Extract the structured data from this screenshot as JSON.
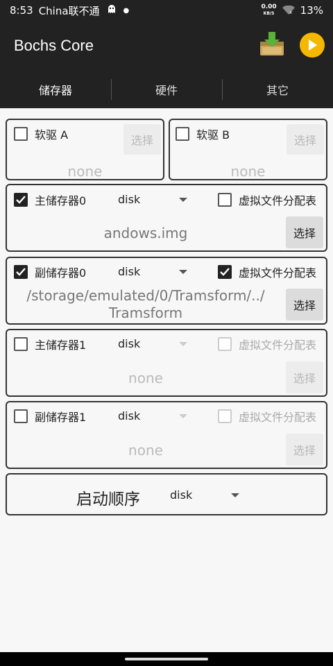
{
  "status": {
    "time": "8:53",
    "carrier": "China联不通",
    "speed_value": "0.00",
    "speed_unit": "KB/S",
    "battery": "13%"
  },
  "app": {
    "title": "Bochs Core",
    "accent": "#f5b800"
  },
  "tabs": [
    {
      "label": "储存器"
    },
    {
      "label": "硬件"
    },
    {
      "label": "其它"
    }
  ],
  "floppy_a": {
    "label": "软驱 A",
    "button": "选择",
    "path": "none",
    "checked": false
  },
  "floppy_b": {
    "label": "软驱 B",
    "button": "选择",
    "path": "none",
    "checked": false
  },
  "storage": [
    {
      "label": "主储存器0",
      "type": "disk",
      "vfat_label": "虚拟文件分配表",
      "checked": true,
      "vfat_checked": false,
      "path": "andows.img",
      "button": "选择",
      "enabled": true
    },
    {
      "label": "副储存器0",
      "type": "disk",
      "vfat_label": "虚拟文件分配表",
      "checked": true,
      "vfat_checked": true,
      "path": "/storage/emulated/0/Tramsform/../\nTramsform",
      "button": "选择",
      "enabled": true
    },
    {
      "label": "主储存器1",
      "type": "disk",
      "vfat_label": "虚拟文件分配表",
      "checked": false,
      "vfat_checked": false,
      "path": "none",
      "button": "选择",
      "enabled": false
    },
    {
      "label": "副储存器1",
      "type": "disk",
      "vfat_label": "虚拟文件分配表",
      "checked": false,
      "vfat_checked": false,
      "path": "none",
      "button": "选择",
      "enabled": false
    }
  ],
  "boot": {
    "label": "启动顺序",
    "value": "disk"
  }
}
